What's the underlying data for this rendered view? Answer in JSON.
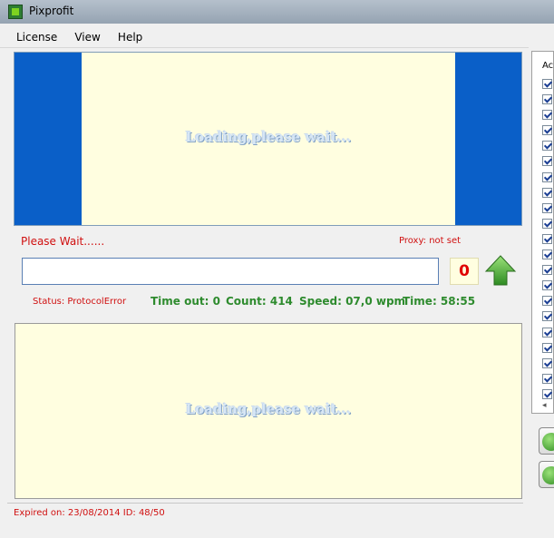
{
  "window": {
    "title": "Pixprofit"
  },
  "menu": [
    "License",
    "View",
    "Help"
  ],
  "top_panel": {
    "loading_text": "Loading,please wait..."
  },
  "status_line": {
    "message": "Please Wait......",
    "proxy": "Proxy: not set"
  },
  "captcha": {
    "input_value": "",
    "counter": "0"
  },
  "stats": {
    "status": "Status: ProtocolError",
    "timeout": "Time out: 0",
    "count": "Count: 414",
    "speed": "Speed: 07,0 wpm",
    "time": "Time: 58:55"
  },
  "bottom_panel": {
    "loading_text": "Loading,please wait..."
  },
  "footer": {
    "expired": "Expired on: 23/08/2014   ID: 48/50"
  },
  "right_panel": {
    "header": "Ac",
    "scroll_left": "◂"
  },
  "icons": {
    "app": "pixprofit-app-icon",
    "upload": "green-up-arrow-icon",
    "refresh": "green-refresh-icon",
    "play": "green-play-icon",
    "checkbox": "checkbox-checked-icon"
  },
  "colors": {
    "panel_blue": "#0a5fc8",
    "panel_cream": "#fffee0",
    "error_red": "#d01010",
    "stats_green": "#2e8b2e",
    "counter_red": "#e00000"
  }
}
